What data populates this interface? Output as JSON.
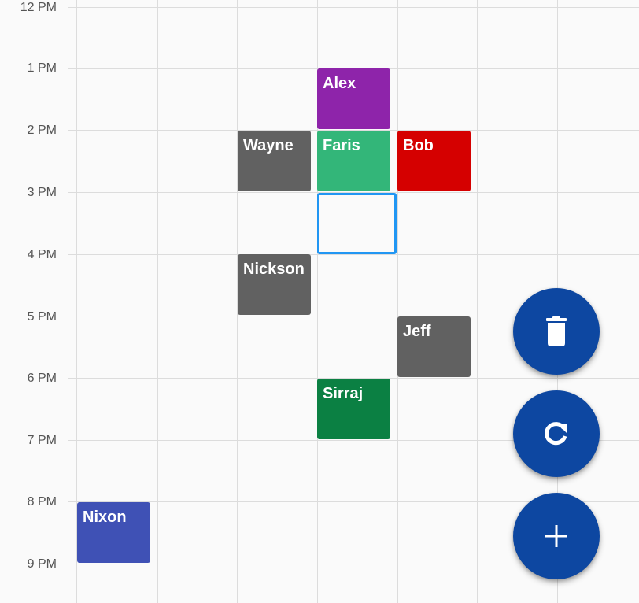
{
  "time_labels": [
    "12 PM",
    "1 PM",
    "2 PM",
    "3 PM",
    "4 PM",
    "5 PM",
    "6 PM",
    "7 PM",
    "8 PM",
    "9 PM"
  ],
  "events": [
    {
      "name": "Alex",
      "color": "#8e24aa"
    },
    {
      "name": "Wayne",
      "color": "#616161"
    },
    {
      "name": "Faris",
      "color": "#33b679"
    },
    {
      "name": "Bob",
      "color": "#d50000"
    },
    {
      "name": "Nickson",
      "color": "#616161"
    },
    {
      "name": "Jeff",
      "color": "#616161"
    },
    {
      "name": "Sirraj",
      "color": "#0b8043"
    },
    {
      "name": "Nixon",
      "color": "#3f51b5"
    }
  ],
  "selection_color": "#2196f3",
  "fab_color": "#0d47a1",
  "fabs": {
    "delete_icon": "trash-icon",
    "refresh_icon": "refresh-icon",
    "add_icon": "plus-icon"
  }
}
